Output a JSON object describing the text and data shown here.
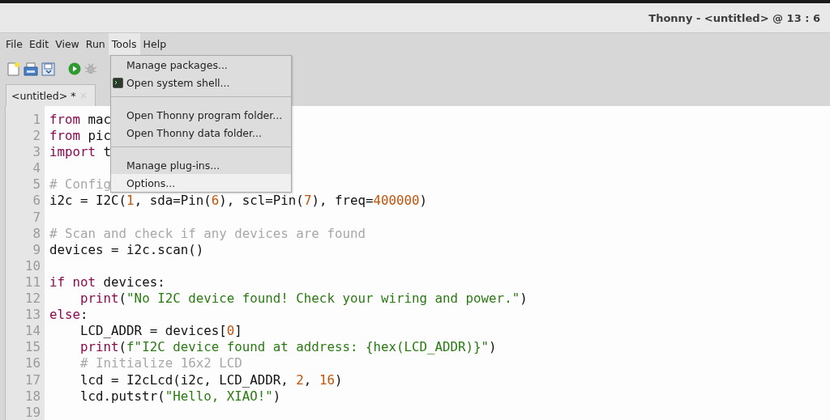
{
  "window": {
    "title": "Thonny - <untitled> @ 13 : 6"
  },
  "menubar": [
    {
      "label": "File",
      "selected": false
    },
    {
      "label": "Edit",
      "selected": false
    },
    {
      "label": "View",
      "selected": false
    },
    {
      "label": "Run",
      "selected": false
    },
    {
      "label": "Tools",
      "selected": true
    },
    {
      "label": "Help",
      "selected": false
    }
  ],
  "toolbar": [
    {
      "kind": "new",
      "disabled": false
    },
    {
      "kind": "open",
      "disabled": false
    },
    {
      "kind": "save",
      "disabled": false
    },
    {
      "kind": "run",
      "disabled": false
    },
    {
      "kind": "debug",
      "disabled": true
    }
  ],
  "tabs": [
    {
      "label": "<untitled> *",
      "selected": true
    }
  ],
  "menu": [
    {
      "kind": "item",
      "label": "Manage packages...",
      "icon": false,
      "selected": false
    },
    {
      "kind": "item",
      "label": "Open system shell...",
      "icon": true,
      "selected": false
    },
    {
      "kind": "separator"
    },
    {
      "kind": "item",
      "label": "Open Thonny program folder...",
      "icon": false,
      "selected": false
    },
    {
      "kind": "item",
      "label": "Open Thonny data folder...",
      "icon": false,
      "selected": false
    },
    {
      "kind": "separator"
    },
    {
      "kind": "item",
      "label": "Manage plug-ins...",
      "icon": false,
      "selected": false
    },
    {
      "kind": "item",
      "label": "Options...",
      "icon": false,
      "selected": true
    }
  ],
  "editor": {
    "lines": [
      {
        "number": "1",
        "tokens": [
          {
            "kind": "keyword",
            "text": "from"
          },
          {
            "kind": "plain",
            "text": " mac"
          }
        ]
      },
      {
        "number": "2",
        "tokens": [
          {
            "kind": "keyword",
            "text": "from"
          },
          {
            "kind": "plain",
            "text": " pic"
          }
        ]
      },
      {
        "number": "3",
        "tokens": [
          {
            "kind": "keyword",
            "text": "import"
          },
          {
            "kind": "plain",
            "text": " t"
          }
        ]
      },
      {
        "number": "4"
      },
      {
        "number": "5",
        "tokens": [
          {
            "kind": "comment",
            "text": "# Config"
          }
        ]
      },
      {
        "number": "6",
        "tokens": [
          {
            "kind": "plain",
            "text": "i2c = I2C("
          },
          {
            "kind": "number",
            "text": "1"
          },
          {
            "kind": "plain",
            "text": ", sda=Pin("
          },
          {
            "kind": "number",
            "text": "6"
          },
          {
            "kind": "plain",
            "text": "), scl=Pin("
          },
          {
            "kind": "number",
            "text": "7"
          },
          {
            "kind": "plain",
            "text": "), freq="
          },
          {
            "kind": "number",
            "text": "400000"
          },
          {
            "kind": "plain",
            "text": ")"
          }
        ]
      },
      {
        "number": "7"
      },
      {
        "number": "8",
        "tokens": [
          {
            "kind": "comment",
            "text": "# Scan and check if any devices are found"
          }
        ]
      },
      {
        "number": "9",
        "tokens": [
          {
            "kind": "plain",
            "text": "devices = i2c.scan()"
          }
        ]
      },
      {
        "number": "10"
      },
      {
        "number": "11",
        "tokens": [
          {
            "kind": "keyword",
            "text": "if not"
          },
          {
            "kind": "plain",
            "text": " devices:"
          }
        ]
      },
      {
        "number": "12",
        "indented": true,
        "tokens": [
          {
            "kind": "keyword",
            "text": "print"
          },
          {
            "kind": "plain",
            "text": "("
          },
          {
            "kind": "string",
            "text": "\"No I2C device found! Check your wiring and power.\""
          },
          {
            "kind": "plain",
            "text": ")"
          }
        ]
      },
      {
        "number": "13",
        "tokens": [
          {
            "kind": "keyword",
            "text": "else"
          },
          {
            "kind": "plain",
            "text": ":"
          }
        ]
      },
      {
        "number": "14",
        "indented": true,
        "tokens": [
          {
            "kind": "plain",
            "text": "LCD_ADDR = devices["
          },
          {
            "kind": "number",
            "text": "0"
          },
          {
            "kind": "plain",
            "text": "]"
          }
        ]
      },
      {
        "number": "15",
        "indented": true,
        "tokens": [
          {
            "kind": "keyword",
            "text": "print"
          },
          {
            "kind": "plain",
            "text": "("
          },
          {
            "kind": "string",
            "text": "f\"I2C device found at address: {hex(LCD_ADDR)}\""
          },
          {
            "kind": "plain",
            "text": ")"
          }
        ]
      },
      {
        "number": "16",
        "indented": true,
        "tokens": [
          {
            "kind": "comment",
            "text": "# Initialize 16x2 LCD"
          }
        ]
      },
      {
        "number": "17",
        "indented": true,
        "tokens": [
          {
            "kind": "plain",
            "text": "lcd = I2cLcd(i2c, LCD_ADDR, "
          },
          {
            "kind": "number",
            "text": "2"
          },
          {
            "kind": "plain",
            "text": ", "
          },
          {
            "kind": "number",
            "text": "16"
          },
          {
            "kind": "plain",
            "text": ")"
          }
        ]
      },
      {
        "number": "18",
        "indented": true,
        "tokens": [
          {
            "kind": "plain",
            "text": "lcd.putstr("
          },
          {
            "kind": "string",
            "text": "\"Hello, XIAO!\""
          },
          {
            "kind": "plain",
            "text": ")"
          }
        ]
      },
      {
        "number": "19"
      }
    ]
  }
}
